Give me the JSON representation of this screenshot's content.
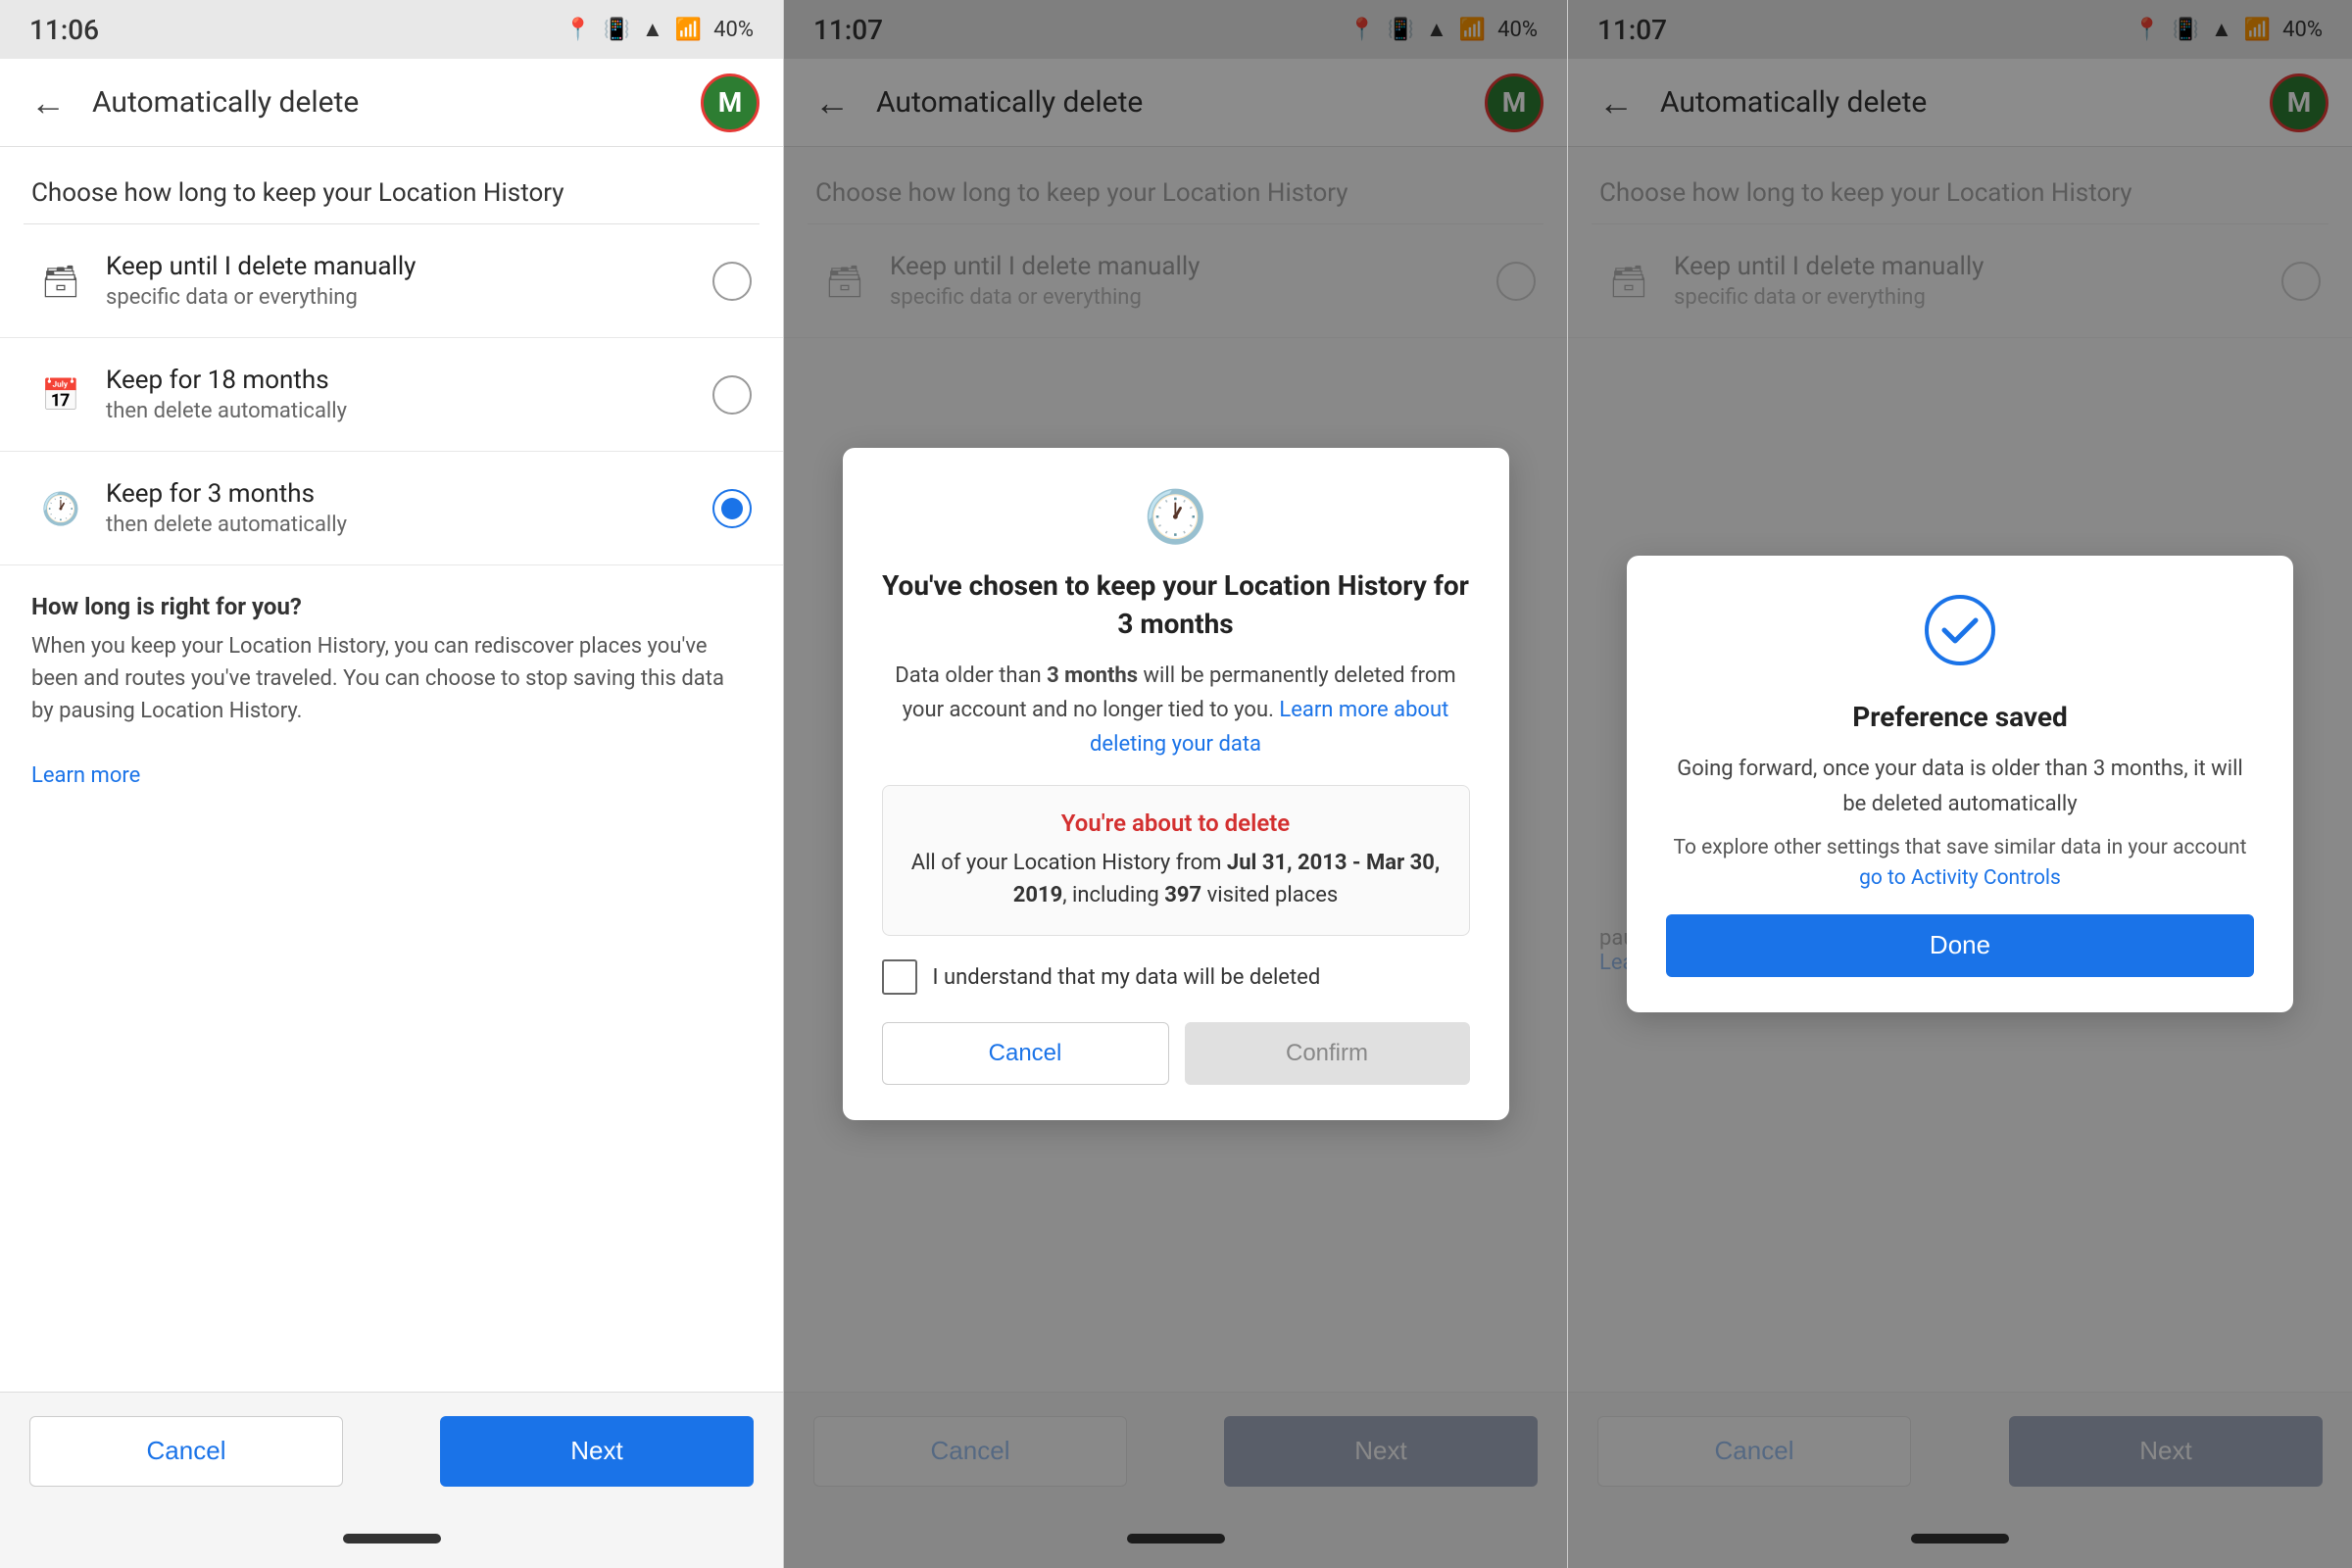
{
  "panel1": {
    "status": {
      "time": "11:06",
      "battery": "40%"
    },
    "topbar": {
      "title": "Automatically delete",
      "avatar_letter": "M"
    },
    "section_title": "Choose how long to keep your Location History",
    "options": [
      {
        "icon": "🗃",
        "title": "Keep until I delete manually",
        "subtitle": "specific data or everything",
        "selected": false
      },
      {
        "icon": "📅",
        "title": "Keep for 18 months",
        "subtitle": "then delete automatically",
        "selected": false
      },
      {
        "icon": "🕐",
        "title": "Keep for 3 months",
        "subtitle": "then delete automatically",
        "selected": true
      }
    ],
    "info": {
      "title": "How long is right for you?",
      "text": "When you keep your Location History, you can rediscover places you've been and routes you've traveled. You can choose to stop saving this data by pausing Location History.",
      "link": "Learn more"
    },
    "buttons": {
      "cancel": "Cancel",
      "next": "Next"
    }
  },
  "panel2": {
    "status": {
      "time": "11:07",
      "battery": "40%"
    },
    "topbar": {
      "title": "Automatically delete",
      "avatar_letter": "M"
    },
    "section_title": "Choose how long to keep your Location History",
    "options": [
      {
        "icon": "🗃",
        "title": "Keep until I delete manually",
        "subtitle": "specific data or everything",
        "selected": false
      }
    ],
    "modal": {
      "icon": "🕐",
      "title": "You've chosen to keep your Location History for 3 months",
      "body_prefix": "Data older than ",
      "bold1": "3 months",
      "body_mid": " will be permanently deleted from your account and no longer tied to you. ",
      "link": "Learn more about deleting your data",
      "delete_box": {
        "title": "You're about to delete",
        "text_prefix": "All of your Location History from ",
        "bold2": "Jul 31, 2013 - Mar 30, 2019",
        "text_mid": ", including ",
        "bold3": "397",
        "text_end": " visited places"
      },
      "checkbox_label": "I understand that my data will be deleted",
      "btn_cancel": "Cancel",
      "btn_confirm": "Confirm"
    },
    "buttons": {
      "cancel": "Cancel",
      "next": "Next"
    }
  },
  "panel3": {
    "status": {
      "time": "11:07",
      "battery": "40%"
    },
    "topbar": {
      "title": "Automatically delete",
      "avatar_letter": "M"
    },
    "section_title": "Choose how long to keep your Location History",
    "options": [
      {
        "icon": "🗃",
        "title": "Keep until I delete manually",
        "subtitle": "specific data or everything",
        "selected": false
      }
    ],
    "modal": {
      "icon": "✔",
      "title": "Preference saved",
      "body": "Going forward, once your data is older than 3 months, it will be deleted automatically",
      "sub": "To explore other settings that save similar data in your account ",
      "link": "go to Activity Controls",
      "btn_done": "Done"
    },
    "info": {
      "text": "pausing Location History.",
      "link": "Learn more"
    },
    "buttons": {
      "cancel": "Cancel",
      "next": "Next"
    }
  }
}
